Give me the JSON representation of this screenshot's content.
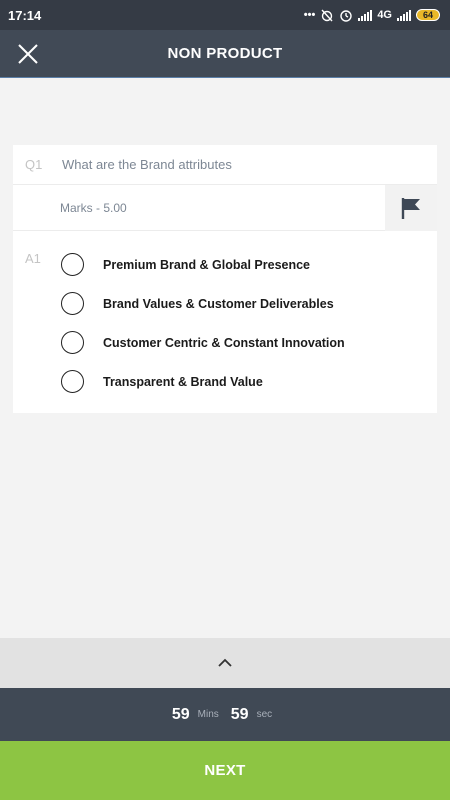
{
  "status_bar": {
    "time": "17:14",
    "network": "4G",
    "battery": "64"
  },
  "header": {
    "title": "NON PRODUCT",
    "close_icon": "close-icon"
  },
  "question": {
    "number": "Q1",
    "text": "What are the Brand attributes",
    "marks": "Marks - 5.00",
    "flag_icon": "flag-icon"
  },
  "answers": {
    "number": "A1",
    "options": [
      {
        "label": "Premium Brand & Global Presence"
      },
      {
        "label": "Brand Values & Customer Deliverables"
      },
      {
        "label": "Customer Centric & Constant Innovation"
      },
      {
        "label": "Transparent & Brand Value"
      }
    ]
  },
  "collapse": {
    "icon": "chevron-up-icon"
  },
  "timer": {
    "minutes": "59",
    "minutes_unit": "Mins",
    "seconds": "59",
    "seconds_unit": "sec"
  },
  "footer": {
    "next_label": "NEXT"
  },
  "colors": {
    "header_bg": "#414a56",
    "accent_green": "#8dc543",
    "timer_bg": "#404955"
  }
}
